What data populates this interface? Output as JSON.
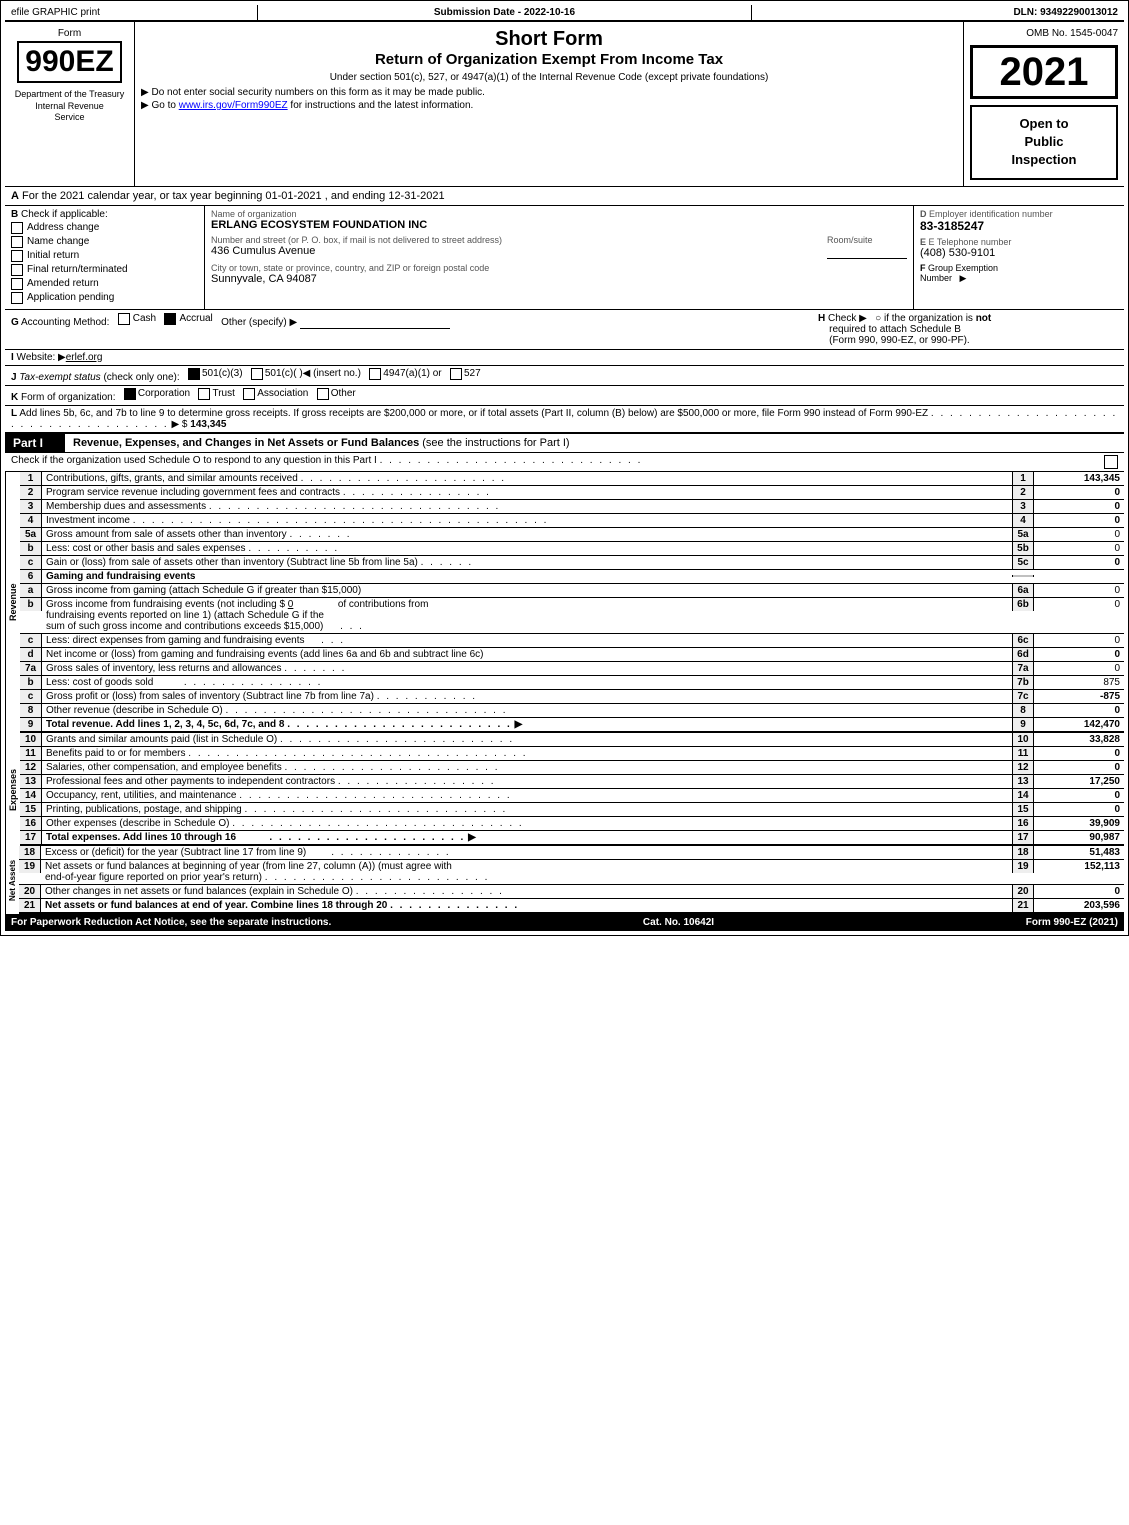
{
  "header": {
    "graphic": "efile GRAPHIC print",
    "submission": "Submission Date - 2022-10-16",
    "dln": "DLN: 93492290013012"
  },
  "form": {
    "omb": "OMB No. 1545-0047",
    "number": "990EZ",
    "title_line1": "Short Form",
    "title_line2": "Return of Organization Exempt From Income Tax",
    "subtitle": "Under section 501(c), 527, or 4947(a)(1) of the Internal Revenue Code (except private foundations)",
    "instruction1": "▶ Do not enter social security numbers on this form as it may be made public.",
    "instruction2": "▶ Go to www.irs.gov/Form990EZ for instructions and the latest information.",
    "year": "2021",
    "open_to_public": "Open to\nPublic\nInspection",
    "dept_label": "Department of the Treasury\nInternal Revenue\nService"
  },
  "section_a": {
    "label": "A",
    "text": "For the 2021 calendar year, or tax year beginning 01-01-2021 , and ending 12-31-2021"
  },
  "section_b": {
    "label": "B",
    "check_label": "Check if applicable:",
    "options": [
      {
        "id": "address_change",
        "label": "Address change",
        "checked": false
      },
      {
        "id": "name_change",
        "label": "Name change",
        "checked": false
      },
      {
        "id": "initial_return",
        "label": "Initial return",
        "checked": false
      },
      {
        "id": "final_return",
        "label": "Final return/terminated",
        "checked": false
      },
      {
        "id": "amended_return",
        "label": "Amended return",
        "checked": false
      },
      {
        "id": "application_pending",
        "label": "Application pending",
        "checked": false
      }
    ]
  },
  "section_c": {
    "label": "C",
    "name_label": "Name of organization",
    "name_value": "ERLANG ECOSYSTEM FOUNDATION INC",
    "address_label": "Number and street (or P. O. box, if mail is not delivered to street address)",
    "address_value": "436 Cumulus Avenue",
    "room_label": "Room/suite",
    "room_value": "",
    "city_label": "City or town, state or province, country, and ZIP or foreign postal code",
    "city_value": "Sunnyvale, CA  94087"
  },
  "section_d": {
    "label": "D",
    "ein_label": "Employer identification number",
    "ein_value": "83-3185247",
    "phone_label": "E Telephone number",
    "phone_value": "(408) 530-9101",
    "group_exemption_label": "F Group Exemption\nNumber",
    "group_exemption_value": "▶"
  },
  "section_g": {
    "label": "G",
    "text": "Accounting Method:",
    "cash": "Cash",
    "accrual_checked": true,
    "accrual": "Accrual",
    "other": "Other (specify) ▶",
    "other_value": ""
  },
  "section_h": {
    "label": "H",
    "text": "Check ▶",
    "description": "○ if the organization is not required to attach Schedule B (Form 990, 990-EZ, or 990-PF)."
  },
  "section_i": {
    "label": "I",
    "text": "Website: ▶erlef.org"
  },
  "section_j": {
    "label": "J",
    "text": "Tax-exempt status (check only one): ☑ 501(c)(3)  ○ 501(c)(  )◀ (insert no.)  ○ 4947(a)(1) or  ○ 527"
  },
  "section_k": {
    "label": "K",
    "text": "Form of organization: ☑ Corporation  ○ Trust  ○ Association  ○ Other"
  },
  "section_l": {
    "label": "L",
    "text": "Add lines 5b, 6c, and 7b to line 9 to determine gross receipts. If gross receipts are $200,000 or more, or if total assets (Part II, column (B) below) are $500,000 or more, file Form 990 instead of Form 990-EZ",
    "dots": ". . . . . . . . . . . . . . . . . . . . . . . . . . . . . . . . . . . . .",
    "arrow": "▶ $",
    "value": "143,345"
  },
  "part1": {
    "title": "Part I",
    "description": "Revenue, Expenses, and Changes in Net Assets or Fund Balances",
    "see_instructions": "(see the instructions for Part I)",
    "check_text": "Check if the organization used Schedule O to respond to any question in this Part I",
    "rows": [
      {
        "num": "1",
        "label": "Contributions, gifts, grants, and similar amounts received",
        "dots": true,
        "line_num": "1",
        "value": "143,345",
        "shaded": false
      },
      {
        "num": "2",
        "label": "Program service revenue including government fees and contracts",
        "dots": true,
        "line_num": "2",
        "value": "0",
        "shaded": false
      },
      {
        "num": "3",
        "label": "Membership dues and assessments",
        "dots": true,
        "line_num": "3",
        "value": "0",
        "shaded": false
      },
      {
        "num": "4",
        "label": "Investment income",
        "dots": true,
        "line_num": "4",
        "value": "0",
        "shaded": false
      },
      {
        "num": "5a",
        "label": "Gross amount from sale of assets other than inventory",
        "sub_line": "5a",
        "sub_value": "0",
        "shaded": false
      },
      {
        "num": "5b",
        "label": "Less: cost or other basis and sales expenses",
        "sub_line": "5b",
        "sub_value": "0",
        "shaded": false
      },
      {
        "num": "5c",
        "label": "Gain or (loss) from sale of assets other than inventory (Subtract line 5b from line 5a)",
        "dots": true,
        "line_num": "5c",
        "value": "0",
        "shaded": false
      },
      {
        "num": "6",
        "label": "Gaming and fundraising events",
        "shaded": false,
        "header": true
      },
      {
        "num": "6a",
        "label": "Gross income from gaming (attach Schedule G if greater than $15,000)",
        "sub_line": "6a",
        "sub_value": "0",
        "shaded": false
      },
      {
        "num": "6b",
        "label_lines": [
          "Gross income from fundraising events (not including $ 0 of contributions from",
          "fundraising events reported on line 1) (attach Schedule G if the",
          "sum of such gross income and contributions exceeds $15,000)"
        ],
        "sub_line": "6b",
        "sub_value": "0",
        "shaded": false
      },
      {
        "num": "6c",
        "label": "Less: direct expenses from gaming and fundraising events",
        "sub_line": "6c",
        "sub_value": "0",
        "shaded": false
      },
      {
        "num": "6d",
        "label": "Net income or (loss) from gaming and fundraising events (add lines 6a and 6b and subtract line 6c)",
        "dots": true,
        "line_num": "6d",
        "value": "0",
        "shaded": false
      },
      {
        "num": "7a",
        "label": "Gross sales of inventory, less returns and allowances",
        "dots": true,
        "sub_line": "7a",
        "sub_value": "0",
        "shaded": false
      },
      {
        "num": "7b",
        "label": "Less: cost of goods sold",
        "sub_line": "7b",
        "sub_value": "875",
        "shaded": false
      },
      {
        "num": "7c",
        "label": "Gross profit or (loss) from sales of inventory (Subtract line 7b from line 7a)",
        "dots": true,
        "line_num": "7c",
        "value": "-875",
        "shaded": false
      },
      {
        "num": "8",
        "label": "Other revenue (describe in Schedule O)",
        "dots": true,
        "line_num": "8",
        "value": "0",
        "shaded": false
      },
      {
        "num": "9",
        "label": "Total revenue. Add lines 1, 2, 3, 4, 5c, 6d, 7c, and 8",
        "dots": true,
        "line_num": "9",
        "value": "142,470",
        "bold": true,
        "arrow": true
      }
    ],
    "expenses_rows": [
      {
        "num": "10",
        "label": "Grants and similar amounts paid (list in Schedule O)",
        "dots": true,
        "line_num": "10",
        "value": "33,828"
      },
      {
        "num": "11",
        "label": "Benefits paid to or for members",
        "dots": true,
        "line_num": "11",
        "value": "0"
      },
      {
        "num": "12",
        "label": "Salaries, other compensation, and employee benefits",
        "dots": true,
        "line_num": "12",
        "value": "0"
      },
      {
        "num": "13",
        "label": "Professional fees and other payments to independent contractors",
        "dots": true,
        "line_num": "13",
        "value": "17,250"
      },
      {
        "num": "14",
        "label": "Occupancy, rent, utilities, and maintenance",
        "dots": true,
        "line_num": "14",
        "value": "0"
      },
      {
        "num": "15",
        "label": "Printing, publications, postage, and shipping",
        "dots": true,
        "line_num": "15",
        "value": "0"
      },
      {
        "num": "16",
        "label": "Other expenses (describe in Schedule O)",
        "dots": true,
        "line_num": "16",
        "value": "39,909"
      },
      {
        "num": "17",
        "label": "Total expenses. Add lines 10 through 16",
        "dots": true,
        "line_num": "17",
        "value": "90,987",
        "bold": true,
        "arrow": true
      }
    ],
    "net_assets_rows": [
      {
        "num": "18",
        "label": "Excess or (deficit) for the year (Subtract line 17 from line 9)",
        "dots": true,
        "line_num": "18",
        "value": "51,483"
      },
      {
        "num": "19",
        "label_lines": [
          "Net assets or fund balances at beginning of year (from line 27, column (A)) (must agree with",
          "end-of-year figure reported on prior year's return)"
        ],
        "dots": true,
        "line_num": "19",
        "value": "152,113"
      },
      {
        "num": "20",
        "label": "Other changes in net assets or fund balances (explain in Schedule O)",
        "dots": true,
        "line_num": "20",
        "value": "0"
      },
      {
        "num": "21",
        "label": "Net assets or fund balances at end of year. Combine lines 18 through 20",
        "dots": true,
        "line_num": "21",
        "value": "203,596",
        "bold": true
      }
    ]
  },
  "footer": {
    "paperwork": "For Paperwork Reduction Act Notice, see the separate instructions.",
    "cat": "Cat. No. 10642I",
    "form": "Form 990-EZ (2021)"
  }
}
